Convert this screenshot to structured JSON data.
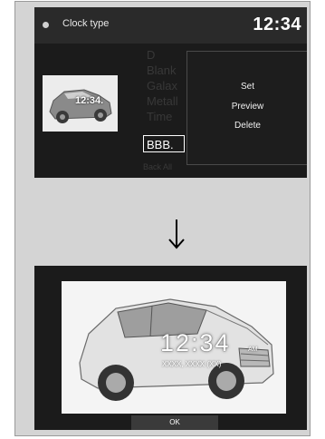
{
  "screen1": {
    "title_icon": "circle-icon",
    "title": "Clock type",
    "time": "12:34",
    "menu_background": [
      "D",
      "Blank",
      "Galax",
      "Metall",
      "Time"
    ],
    "selected_item": "BBB.",
    "thumbnail_time": "12:34.",
    "bottom_hint": "Back  All",
    "popup_menu": {
      "set": "Set",
      "preview": "Preview",
      "delete": "Delete"
    }
  },
  "arrow_icon": "down-arrow-icon",
  "screen2": {
    "clock_time": "12:34",
    "ampm": "AM",
    "date": "XXXX, XXXX (XX)",
    "ok_label": "OK"
  }
}
